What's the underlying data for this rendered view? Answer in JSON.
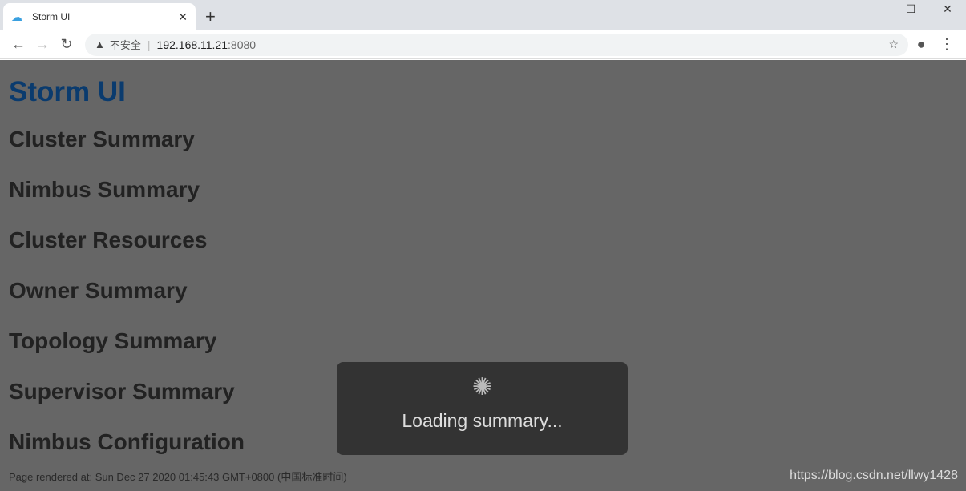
{
  "browser": {
    "tab_title": "Storm UI",
    "security_label": "不安全",
    "host": "192.168.11.21",
    "port": ":8080"
  },
  "page": {
    "title": "Storm UI",
    "sections": [
      "Cluster Summary",
      "Nimbus Summary",
      "Cluster Resources",
      "Owner Summary",
      "Topology Summary",
      "Supervisor Summary",
      "Nimbus Configuration"
    ],
    "footer": "Page rendered at: Sun Dec 27 2020 01:45:43 GMT+0800 (中国标准时间)",
    "loading": "Loading summary...",
    "watermark": "https://blog.csdn.net/llwy1428"
  }
}
